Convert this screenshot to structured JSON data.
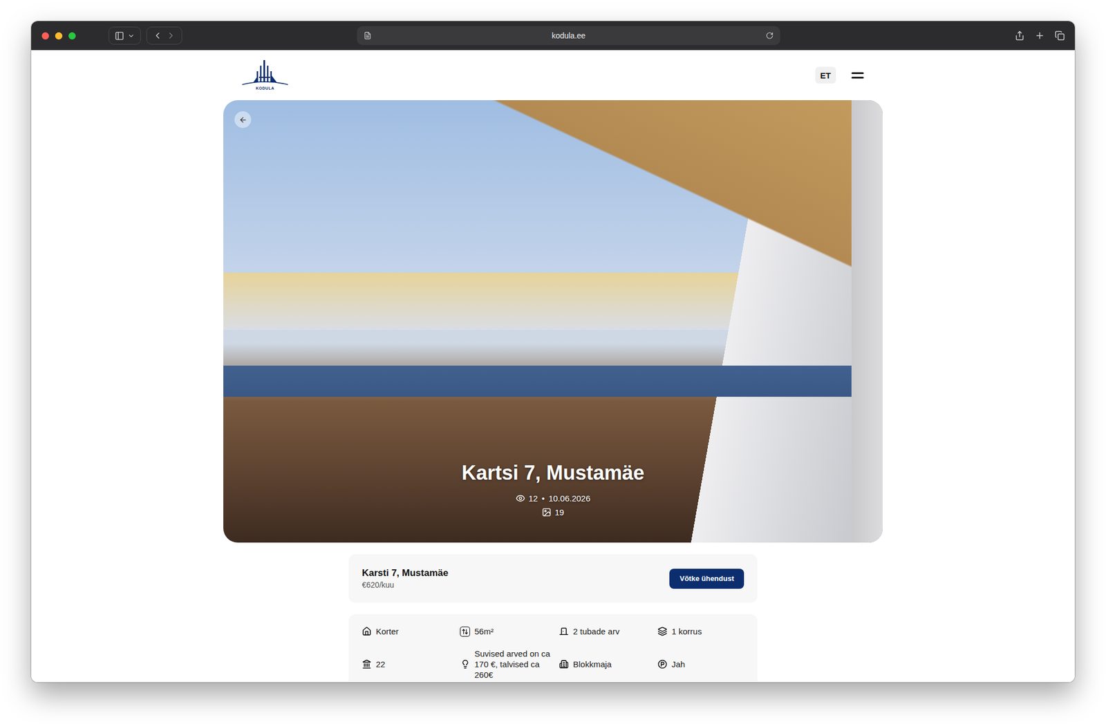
{
  "browser": {
    "url": "kodula.ee",
    "traffic_lights": [
      {
        "name": "close",
        "color": "#ff5f57"
      },
      {
        "name": "minimize",
        "color": "#febc2e"
      },
      {
        "name": "zoom",
        "color": "#28c840"
      }
    ]
  },
  "header": {
    "logo_text": "KODULA",
    "language": "ET"
  },
  "hero": {
    "title": "Kartsi 7, Mustamäe",
    "views": "12",
    "separator": "•",
    "date": "10.06.2026",
    "photos": "19"
  },
  "summary": {
    "title": "Karsti 7, Mustamäe",
    "price": "€620/kuu",
    "button": "Võtke ühendust"
  },
  "details": [
    {
      "kind": "type",
      "label": "Korter"
    },
    {
      "kind": "area",
      "label": "56m²"
    },
    {
      "kind": "rooms",
      "label": "2 tubade arv"
    },
    {
      "kind": "floor",
      "label": "1 korrus"
    },
    {
      "kind": "number",
      "label": "22"
    },
    {
      "kind": "utilities",
      "label": "Suvised arved on ca 170 €, talvised ca 260€"
    },
    {
      "kind": "building",
      "label": "Blokkmaja"
    },
    {
      "kind": "parking",
      "label": "Jah"
    }
  ]
}
